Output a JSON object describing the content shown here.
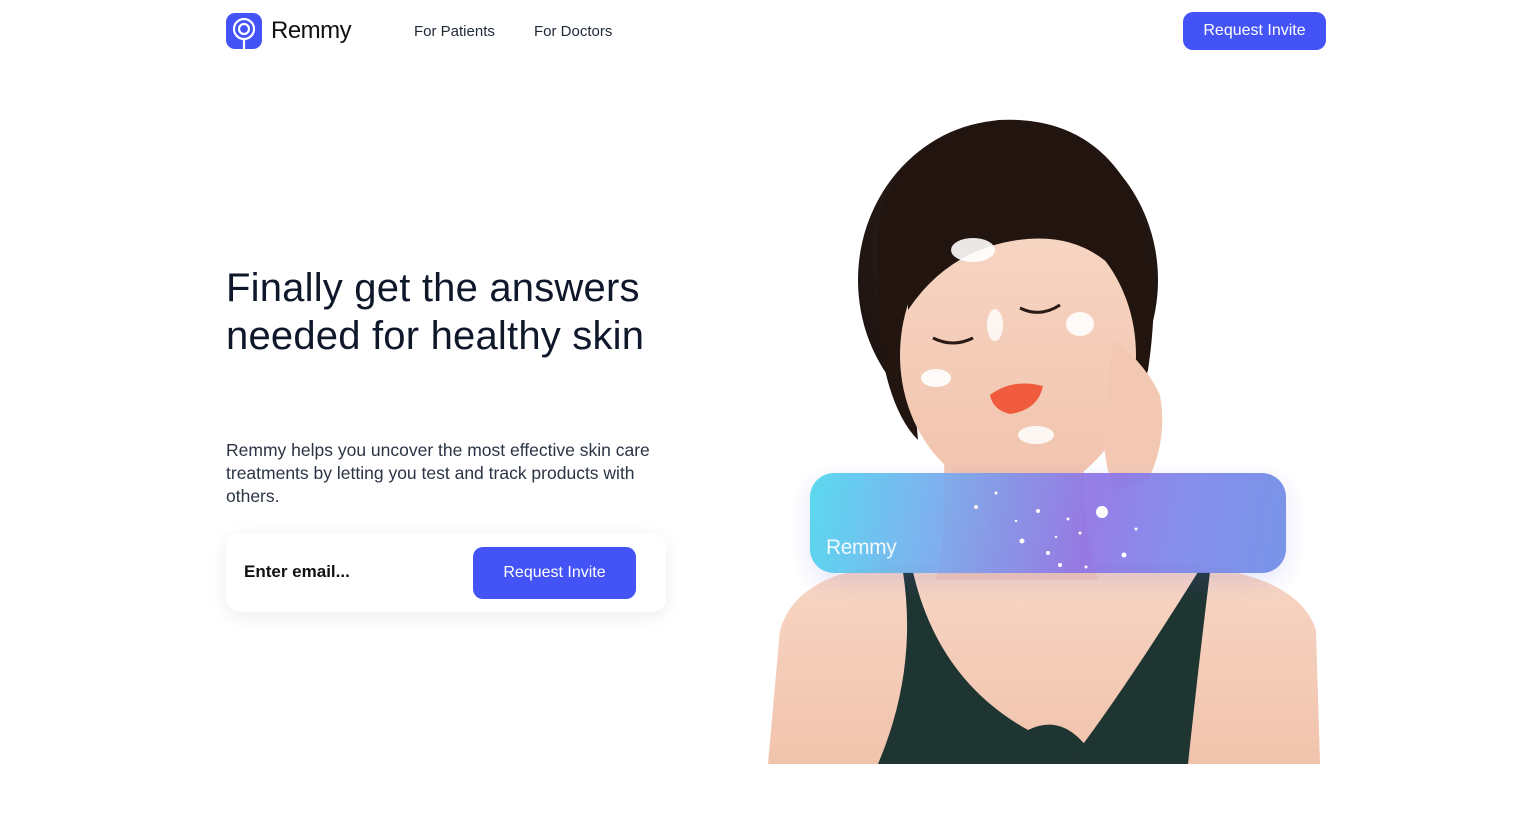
{
  "brand": {
    "name": "Remmy",
    "color": "#4353f5"
  },
  "nav": {
    "links": [
      {
        "label": "For Patients"
      },
      {
        "label": "For Doctors"
      }
    ],
    "cta_label": "Request Invite"
  },
  "hero": {
    "title_line1": "Finally get the answers",
    "title_line2": "needed for healthy skin",
    "description": "Remmy helps you uncover the most effective skin care treatments by letting you test and track products with others.",
    "email_placeholder": "Enter email...",
    "cta_label": "Request Invite"
  },
  "card": {
    "label": "Remmy"
  }
}
